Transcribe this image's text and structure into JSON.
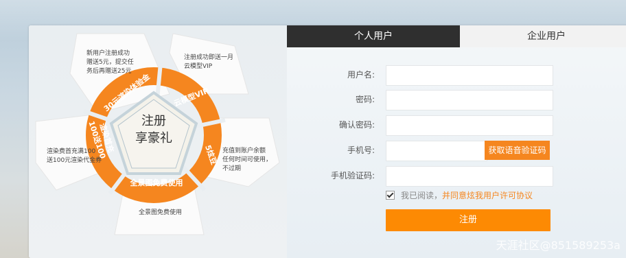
{
  "tabs": {
    "personal": "个人用户",
    "enterprise": "企业用户"
  },
  "form": {
    "username_label": "用户名:",
    "password_label": "密码:",
    "confirm_label": "确认密码:",
    "phone_label": "手机号:",
    "verify_label": "手机验证码:",
    "voice_code_button": "获取语音验证码",
    "agree_prefix": "我已阅读，",
    "agree_link": "并同意炫我用户许可协议",
    "submit_label": "注册"
  },
  "promo": {
    "center_line1": "注册",
    "center_line2": "享豪礼",
    "petals": [
      {
        "badge": "30元渲染体验金",
        "desc": [
          "新用户注册成功",
          "赠送5元，提交任",
          "务后再赠送25元"
        ]
      },
      {
        "badge": "云模型VIP",
        "desc": [
          "注册成功即送一月",
          "云模型VIP"
        ]
      },
      {
        "badge": "5炫豆",
        "desc": [
          "充值到账户余额",
          "任何时间可使用，",
          "不过期"
        ]
      },
      {
        "badge": "全景图免费使用",
        "desc": [
          "全景图免费使用"
        ]
      },
      {
        "badge": "渲染首充100送100",
        "badge_line1": "渲染首充",
        "badge_line2": "100送100",
        "desc": [
          "渲染费首充满100",
          "送100元渲染代金券"
        ]
      }
    ]
  },
  "watermark": "天涯社区@851589253a",
  "colors": {
    "accent": "#f5861f",
    "dark_tab": "#2f2f2f",
    "submit": "#fd8a03"
  },
  "checkbox_checked": true
}
